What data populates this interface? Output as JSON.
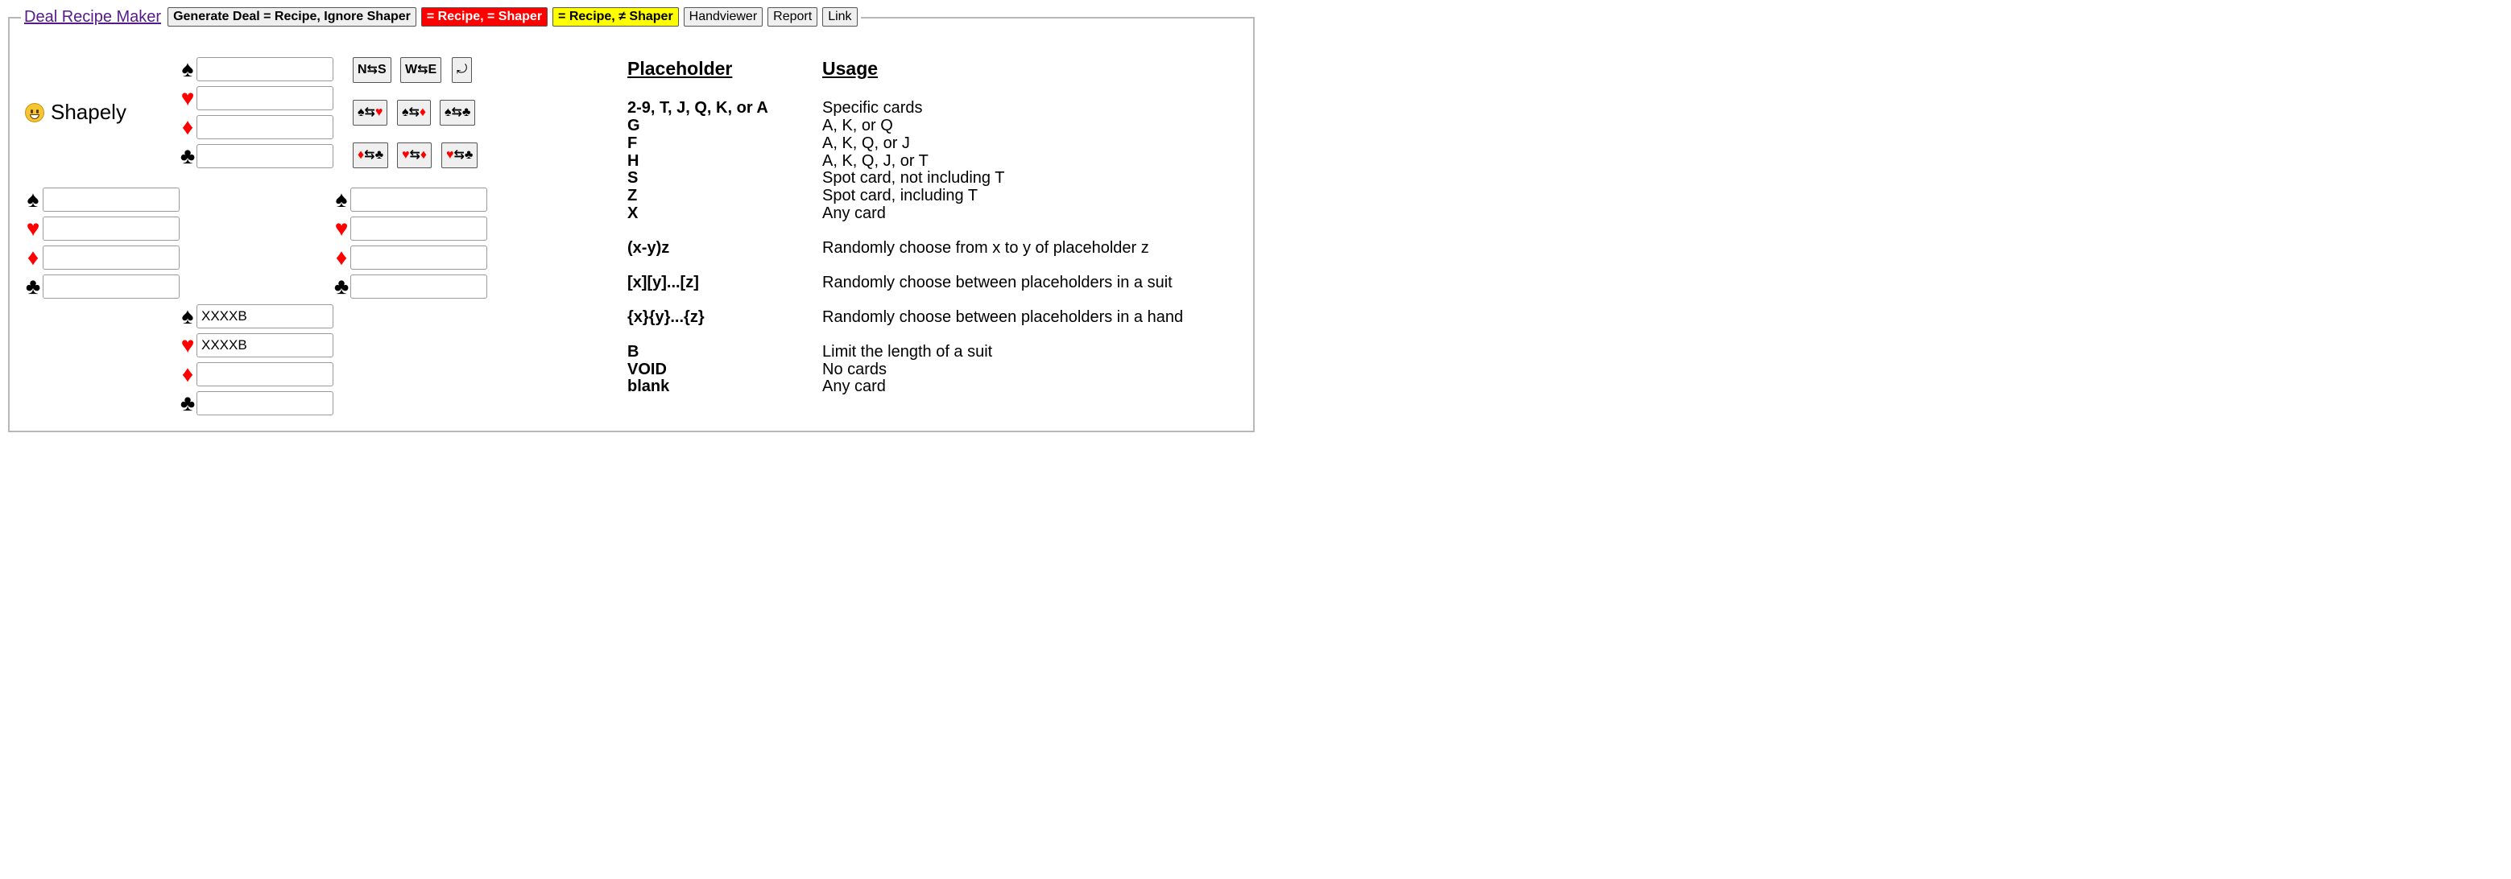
{
  "header": {
    "title_link": "Deal Recipe Maker",
    "buttons": [
      "Generate Deal = Recipe, Ignore Shaper",
      "= Recipe, = Shaper",
      "= Recipe, ≠ Shaper",
      "Handviewer",
      "Report",
      "Link"
    ]
  },
  "shaper": {
    "emoji": "grinning-face-icon",
    "label": "Shapely"
  },
  "suits": {
    "spades": "♠",
    "hearts": "♥",
    "diamonds": "♦",
    "clubs": "♣"
  },
  "hands": {
    "north": {
      "spades": "",
      "hearts": "",
      "diamonds": "",
      "clubs": ""
    },
    "west": {
      "spades": "",
      "hearts": "",
      "diamonds": "",
      "clubs": ""
    },
    "east": {
      "spades": "",
      "hearts": "",
      "diamonds": "",
      "clubs": ""
    },
    "south": {
      "spades": "XXXXB",
      "hearts": "XXXXB",
      "diamonds": "",
      "clubs": ""
    }
  },
  "swap_buttons": {
    "ns": "N⇆S",
    "we": "W⇆E",
    "rotate": "⤾"
  },
  "colors": {
    "red": "#ff0000",
    "yellow": "#ffff00",
    "link": "#551a8b"
  },
  "reference": {
    "headers": {
      "placeholder": "Placeholder",
      "usage": "Usage"
    },
    "rows": [
      {
        "placeholder": "2-9, T, J, Q, K, or A",
        "usage": "Specific cards"
      },
      {
        "placeholder": "G",
        "usage": "A, K, or Q"
      },
      {
        "placeholder": "F",
        "usage": "A, K, Q, or J"
      },
      {
        "placeholder": "H",
        "usage": "A, K, Q, J, or T"
      },
      {
        "placeholder": "S",
        "usage": "Spot card, not including T"
      },
      {
        "placeholder": "Z",
        "usage": "Spot card, including T"
      },
      {
        "placeholder": "X",
        "usage": "Any card"
      },
      {
        "placeholder": "(x-y)z",
        "usage": "Randomly choose from x to y of placeholder z"
      },
      {
        "placeholder": "[x][y]...[z]",
        "usage": "Randomly choose between placeholders in a suit"
      },
      {
        "placeholder": "{x}{y}...{z}",
        "usage": "Randomly choose between placeholders in a hand"
      },
      {
        "placeholder": "B",
        "usage": "Limit the length of a suit"
      },
      {
        "placeholder": "VOID",
        "usage": "No cards"
      },
      {
        "placeholder": "blank",
        "usage": "Any card"
      }
    ]
  }
}
